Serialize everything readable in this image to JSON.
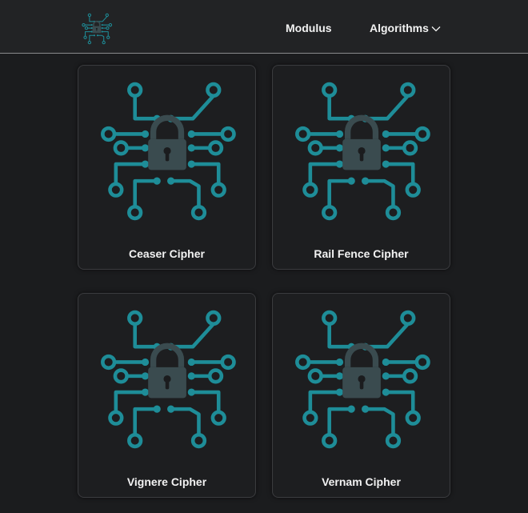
{
  "colors": {
    "accent": "#1e8d98",
    "lock": "#3a4b4f",
    "background": "#1b1c1e",
    "navbar": "#222325",
    "text": "#f2f2f2"
  },
  "navbar": {
    "logo_icon": "circuit-lock-icon",
    "links": {
      "modulus": "Modulus",
      "algorithms": "Algorithms"
    },
    "algorithms_icon": "chevron-down-icon"
  },
  "cards": [
    {
      "label": "Ceaser Cipher",
      "icon": "circuit-lock-icon"
    },
    {
      "label": "Rail Fence Cipher",
      "icon": "circuit-lock-icon"
    },
    {
      "label": "Vignere Cipher",
      "icon": "circuit-lock-icon"
    },
    {
      "label": "Vernam Cipher",
      "icon": "circuit-lock-icon"
    }
  ]
}
